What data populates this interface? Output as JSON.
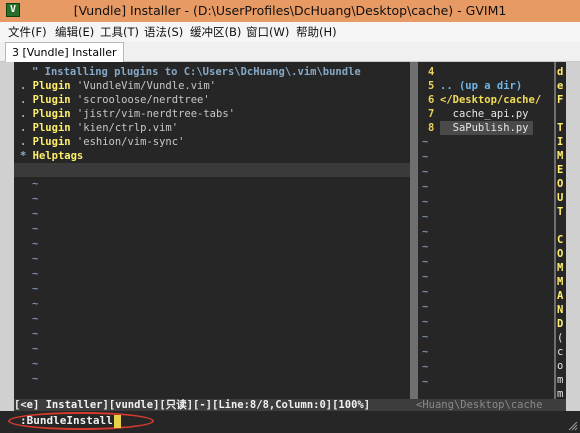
{
  "window": {
    "title": "[Vundle] Installer - (D:\\UserProfiles\\DcHuang\\Desktop\\cache) - GVIM1",
    "icon": "vim-icon"
  },
  "menu": {
    "items": [
      "文件(F)",
      "编辑(E)",
      "工具(T)",
      "语法(S)",
      "缓冲区(B)",
      "窗口(W)",
      "帮助(H)"
    ]
  },
  "tabs": [
    {
      "label": "3 [Vundle] Installer",
      "active": true
    }
  ],
  "installer": {
    "header": "\" Installing plugins to C:\\Users\\DcHuang\\.vim\\bundle",
    "lines": [
      {
        "bullet": ".",
        "keyword": "Plugin",
        "arg": "'VundleVim/Vundle.vim'"
      },
      {
        "bullet": ".",
        "keyword": "Plugin",
        "arg": "'scrooloose/nerdtree'"
      },
      {
        "bullet": ".",
        "keyword": "Plugin",
        "arg": "'jistr/vim-nerdtree-tabs'"
      },
      {
        "bullet": ".",
        "keyword": "Plugin",
        "arg": "'kien/ctrlp.vim'"
      },
      {
        "bullet": ".",
        "keyword": "Plugin",
        "arg": "'eshion/vim-sync'"
      },
      {
        "bullet": "*",
        "keyword": "Helptags",
        "arg": ""
      }
    ],
    "tilde": "~"
  },
  "filetree": {
    "line_numbers": [
      "4",
      "5",
      "6",
      "7",
      "8"
    ],
    "entries": [
      {
        "text": "",
        "kind": "blank"
      },
      {
        "text": ".. (up a dir)",
        "kind": "up"
      },
      {
        "text": "</Desktop/cache/",
        "kind": "path"
      },
      {
        "text": "  cache_api.py",
        "kind": "file"
      },
      {
        "text": "  SaPublish.py",
        "kind": "file-selected"
      }
    ]
  },
  "right_pane": {
    "chars": [
      "d",
      "e",
      "F",
      "",
      "T",
      "I",
      "M",
      "E",
      "O",
      "U",
      "T",
      "",
      "C",
      "O",
      "M",
      "M",
      "A",
      "N",
      "D",
      "(",
      "c",
      "o",
      "m",
      "m"
    ]
  },
  "statusline": {
    "active": "[<e] Installer][vundle][只读][-][Line:8/8,Column:0][100%]",
    "inactive": "<Huang\\Desktop\\cache"
  },
  "cmdline": {
    "text": ":BundleInstall"
  },
  "colors": {
    "titlebar": "#e79a63",
    "vim_bg": "#262626",
    "keyword": "#ffef6a",
    "annotation_circle": "#d43b2e"
  }
}
